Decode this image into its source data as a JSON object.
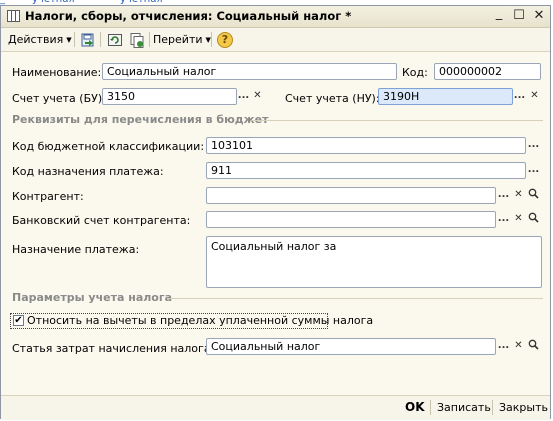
{
  "window": {
    "title": "Налоги, сборы, отчисления: Социальный налог *",
    "minimize_glyph": "_",
    "maximize_glyph": "☐",
    "close_glyph": "✕"
  },
  "toolbar": {
    "actions_label": "Действия",
    "goto_label": "Перейти",
    "help_glyph": "?"
  },
  "form": {
    "name_label": "Наименование:",
    "name_value": "Социальный налог",
    "code_label": "Код:",
    "code_value": "000000002",
    "account_bu_label": "Счет учета (БУ):",
    "account_bu_value": "3150",
    "account_nu_label": "Счет учета (НУ):",
    "account_nu_value": "3190Н"
  },
  "budget_section": {
    "title": "Реквизиты для перечисления в бюджет",
    "kbk_label": "Код бюджетной классификации:",
    "kbk_value": "103101",
    "purpose_code_label": "Код назначения платежа:",
    "purpose_code_value": "911",
    "counterparty_label": "Контрагент:",
    "counterparty_value": "",
    "bank_account_label": "Банковский счет контрагента:",
    "bank_account_value": "",
    "payment_purpose_label": "Назначение платежа:",
    "payment_purpose_value": "Социальный налог за"
  },
  "tax_section": {
    "title": "Параметры учета налога",
    "deduction_checkbox_label": "Относить на вычеты в пределах уплаченной суммы налога",
    "deduction_checked": true,
    "check_glyph": "✔",
    "expense_item_label": "Статья затрат начисления налога:",
    "expense_item_value": "Социальный налог"
  },
  "buttons": {
    "select_glyph": "...",
    "clear_glyph": "✕",
    "open_glyph": "⚲"
  },
  "bottom": {
    "ok_label": "OK",
    "save_label": "Записать",
    "close_label": "Закрыть"
  }
}
